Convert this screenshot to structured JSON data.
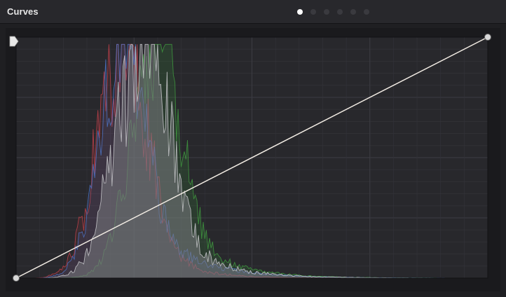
{
  "panel": {
    "title": "Curves",
    "page_indicator": {
      "count": 6,
      "active_index": 0
    }
  },
  "colors": {
    "background": "#1f1f22",
    "plot_background": "#28282c",
    "grid": "#34343a",
    "curve": "#f2ece4",
    "histogram_luma": "#7a7a80",
    "histogram_red": "#c0404a",
    "histogram_green": "#3f9a3f",
    "histogram_blue": "#4d74c8",
    "control_point": "#d9d9d9"
  },
  "icons": {
    "soft_clip_handle": "triangle-right-tab-icon",
    "control_point": "circle-handle-icon"
  },
  "chart_data": {
    "type": "line",
    "curve_points": [
      {
        "input": 0,
        "output": 0
      },
      {
        "input": 1,
        "output": 1
      }
    ],
    "x_range": [
      0,
      1
    ],
    "y_range": [
      0,
      1
    ],
    "grid": {
      "shown": true,
      "divisions": 4
    }
  }
}
